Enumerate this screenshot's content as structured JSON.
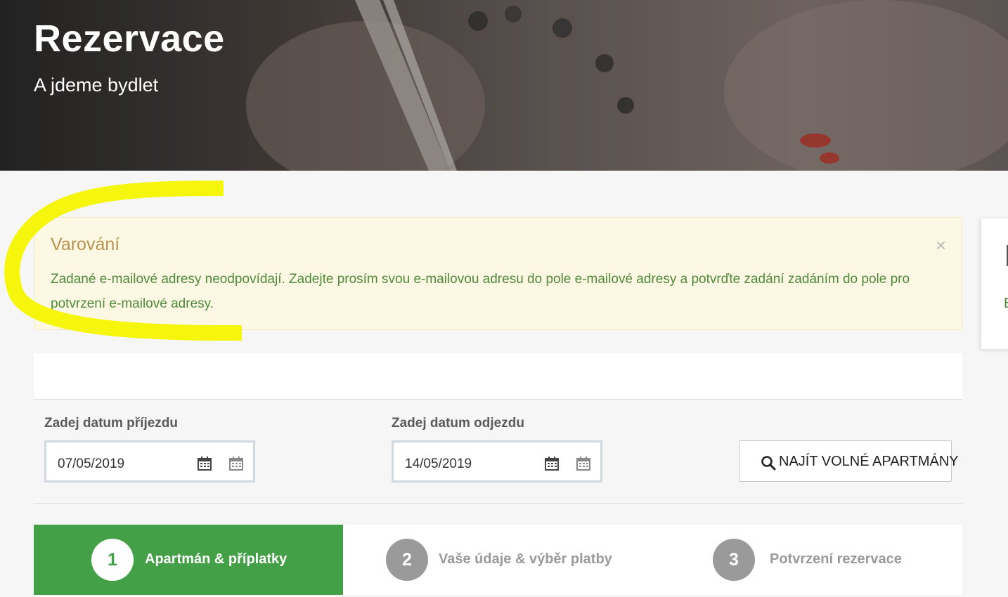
{
  "hero": {
    "title": "Rezervace",
    "subtitle": "A jdeme bydlet"
  },
  "alert": {
    "title": "Varování",
    "close": "×",
    "message": "Zadané e-mailové adresy neodpovídají. Zadejte prosím svou e-mailovou adresu do pole e-mailové adresy a potvrďte zadání zadáním do pole pro potvrzení e-mailové adresy."
  },
  "side_card": {
    "text": "E"
  },
  "search": {
    "arrival_label": "Zadej datum příjezdu",
    "arrival_value": "07/05/2019",
    "departure_label": "Zadej datum odjezdu",
    "departure_value": "14/05/2019",
    "button_label": "NAJÍT VOLNÉ APARTMÁNY"
  },
  "steps": [
    {
      "number": "1",
      "label": "Apartmán & příplatky",
      "active": true
    },
    {
      "number": "2",
      "label": "Vaše údaje & výběr platby",
      "active": false
    },
    {
      "number": "3",
      "label": "Potvrzení rezervace",
      "active": false
    }
  ],
  "colors": {
    "accent_green": "#43a047",
    "warning_bg": "#fcf8e3",
    "warning_title": "#b89250",
    "warning_text": "#4f8a3a",
    "marker_yellow": "#f5f500"
  },
  "icons": {
    "calendar": "calendar-icon",
    "search": "search-icon",
    "close": "close-icon"
  }
}
